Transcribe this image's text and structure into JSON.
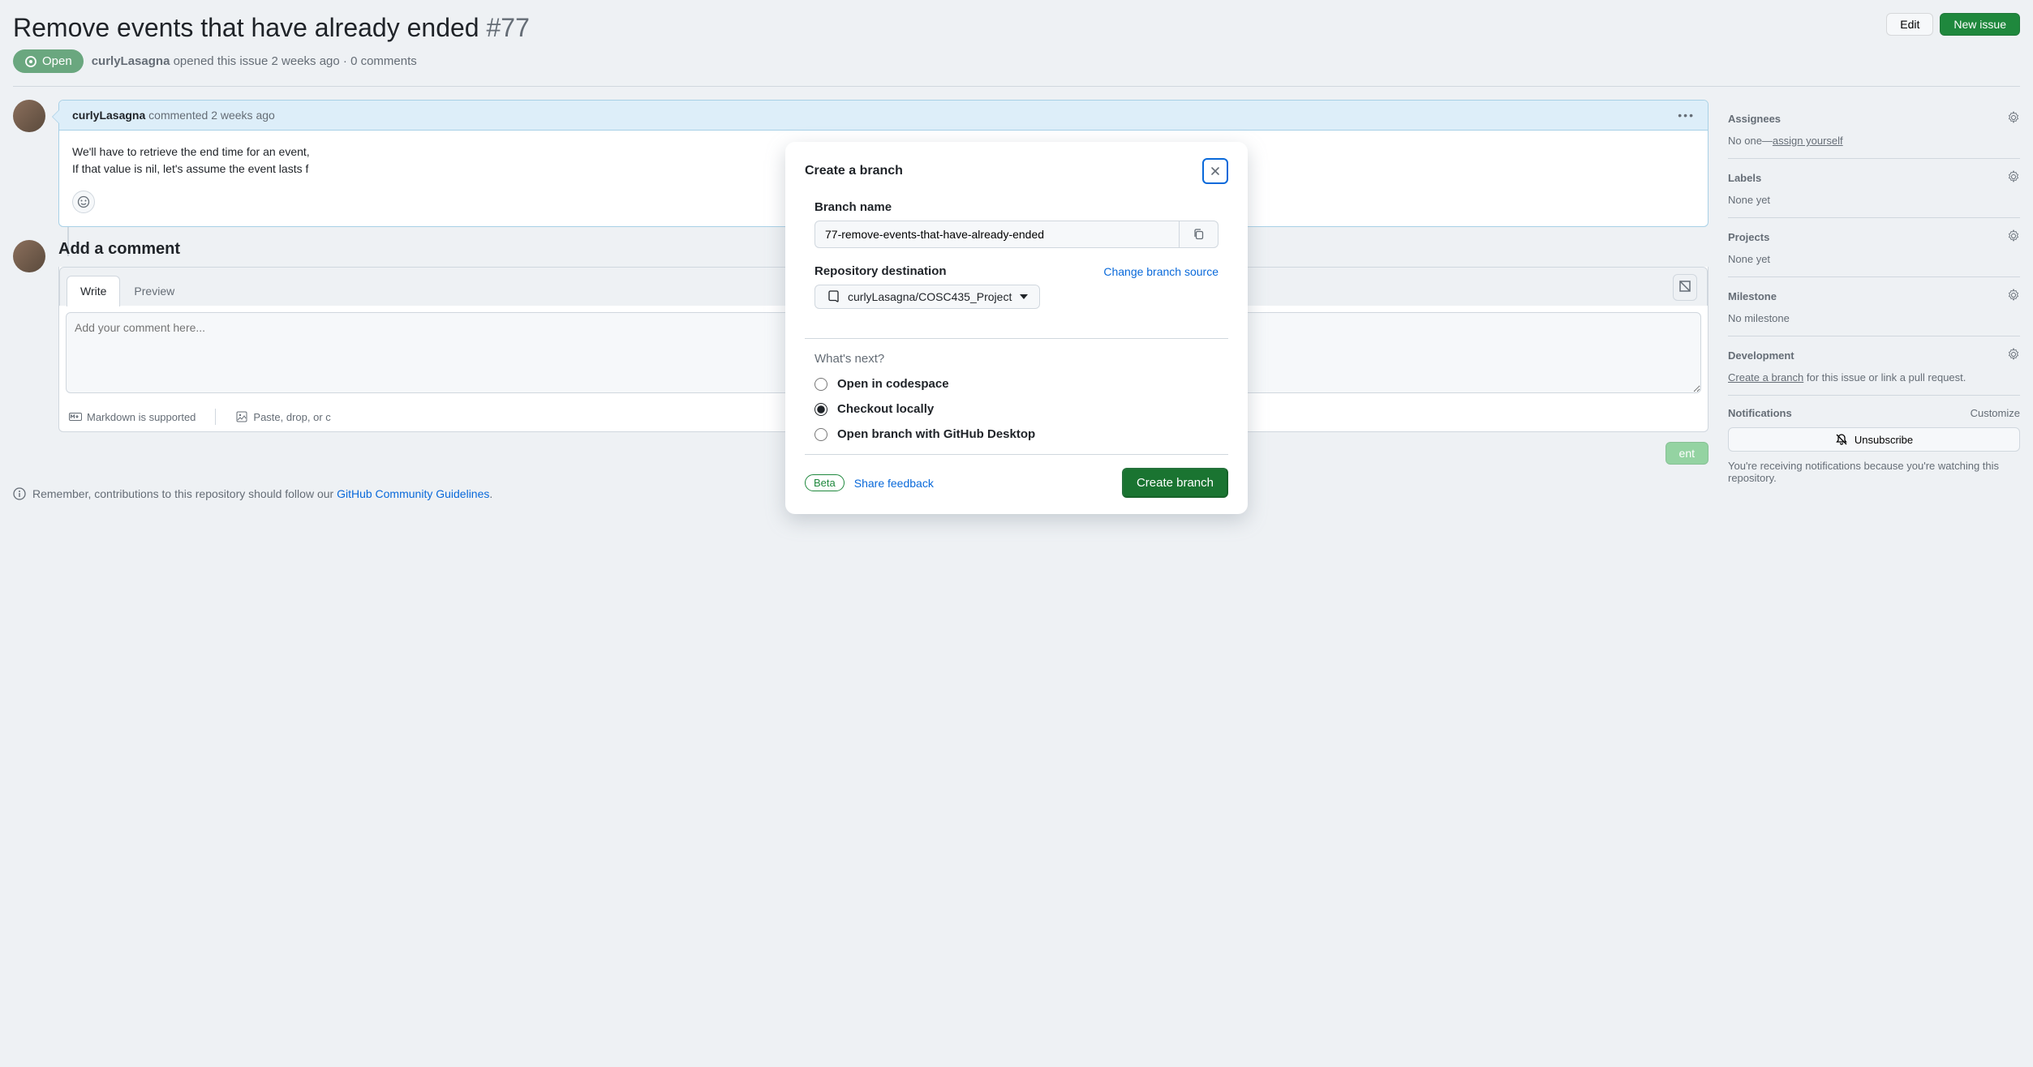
{
  "issue": {
    "title": "Remove events that have already ended",
    "number": "#77",
    "edit_btn": "Edit",
    "new_issue_btn": "New issue",
    "state": "Open",
    "author": "curlyLasagna",
    "opened_text": "opened this issue 2 weeks ago",
    "comments_text": "0 comments"
  },
  "comment": {
    "author": "curlyLasagna",
    "commented_text": "commented 2 weeks ago",
    "body_line1": "We'll have to retrieve the end time for an event,",
    "body_line2": "If that value is nil, let's assume the event lasts f"
  },
  "editor": {
    "title": "Add a comment",
    "tab_write": "Write",
    "tab_preview": "Preview",
    "placeholder": "Add your comment here...",
    "markdown_note": "Markdown is supported",
    "paste_note": "Paste, drop, or c",
    "hidden_btn": "ent"
  },
  "contrib": {
    "prefix": "Remember, contributions to this repository should follow our ",
    "link": "GitHub Community Guidelines",
    "suffix": "."
  },
  "sidebar": {
    "assignees": {
      "title": "Assignees",
      "none": "No one—",
      "assign": "assign yourself"
    },
    "labels": {
      "title": "Labels",
      "value": "None yet"
    },
    "projects": {
      "title": "Projects",
      "value": "None yet"
    },
    "milestone": {
      "title": "Milestone",
      "value": "No milestone"
    },
    "development": {
      "title": "Development",
      "create_link": "Create a branch",
      "text": " for this issue or link a pull request."
    },
    "notifications": {
      "title": "Notifications",
      "customize": "Customize",
      "unsubscribe": "Unsubscribe",
      "note": "You're receiving notifications because you're watching this repository."
    }
  },
  "modal": {
    "title": "Create a branch",
    "branch_label": "Branch name",
    "branch_value": "77-remove-events-that-have-already-ended",
    "repo_label": "Repository destination",
    "change_source": "Change branch source",
    "repo_value": "curlyLasagna/COSC435_Project",
    "whats_next": "What's next?",
    "options": {
      "codespace": "Open in codespace",
      "checkout": "Checkout locally",
      "desktop": "Open branch with GitHub Desktop"
    },
    "beta": "Beta",
    "feedback": "Share feedback",
    "submit": "Create branch"
  }
}
